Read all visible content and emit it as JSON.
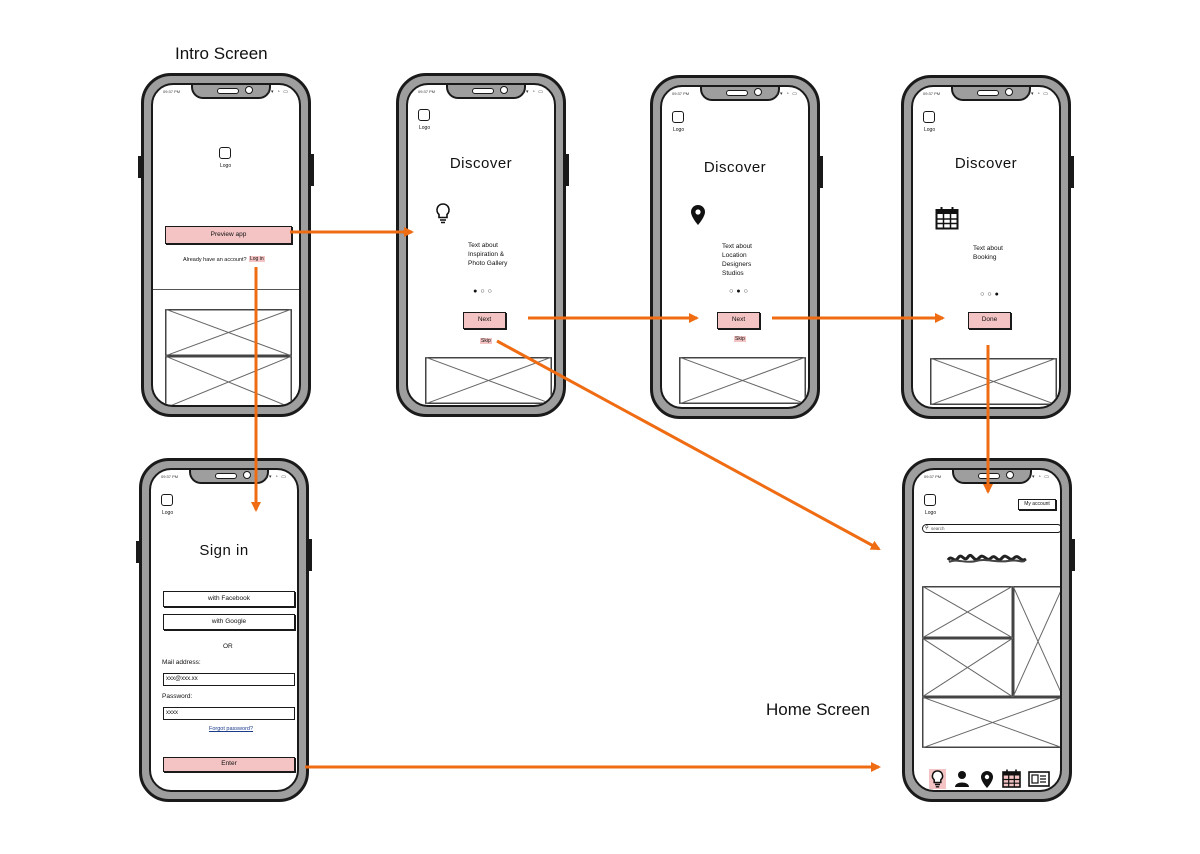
{
  "captions": {
    "intro": "Intro Screen",
    "home": "Home Screen"
  },
  "status_time": "09:37 PM",
  "logo_label": "Logo",
  "intro": {
    "preview_button": "Preview app",
    "have_account": "Already have an account?",
    "login_link": "Log in"
  },
  "discover1": {
    "title": "Discover",
    "icon": "lightbulb-icon",
    "text": "Text about\nInspiration &\nPhoto Gallery",
    "next": "Next",
    "skip": "Skip",
    "active_page": 1
  },
  "discover2": {
    "title": "Discover",
    "icon": "map-pin-icon",
    "text": "Text about\nLocation\nDesigners\nStudios",
    "next": "Next",
    "skip": "Skip",
    "active_page": 2
  },
  "discover3": {
    "title": "Discover",
    "icon": "calendar-icon",
    "text": "Text about\nBooking",
    "done": "Done",
    "active_page": 3
  },
  "signin": {
    "title": "Sign in",
    "facebook": "with Facebook",
    "google": "with Google",
    "or": "OR",
    "mail_label": "Mail address:",
    "mail_value": "xxx@xxx.xx",
    "password_label": "Password:",
    "password_value": "xxxx",
    "forgot": "Forgot password?",
    "enter": "Enter"
  },
  "home": {
    "my_account": "My account",
    "search_placeholder": "search",
    "nav_icons": [
      "lightbulb-icon",
      "user-icon",
      "map-pin-icon",
      "calendar-icon",
      "news-icon"
    ]
  },
  "colors": {
    "accent": "#ef6c13",
    "button_fill": "#f4c4c4",
    "phone_body": "#9e9e9e"
  }
}
